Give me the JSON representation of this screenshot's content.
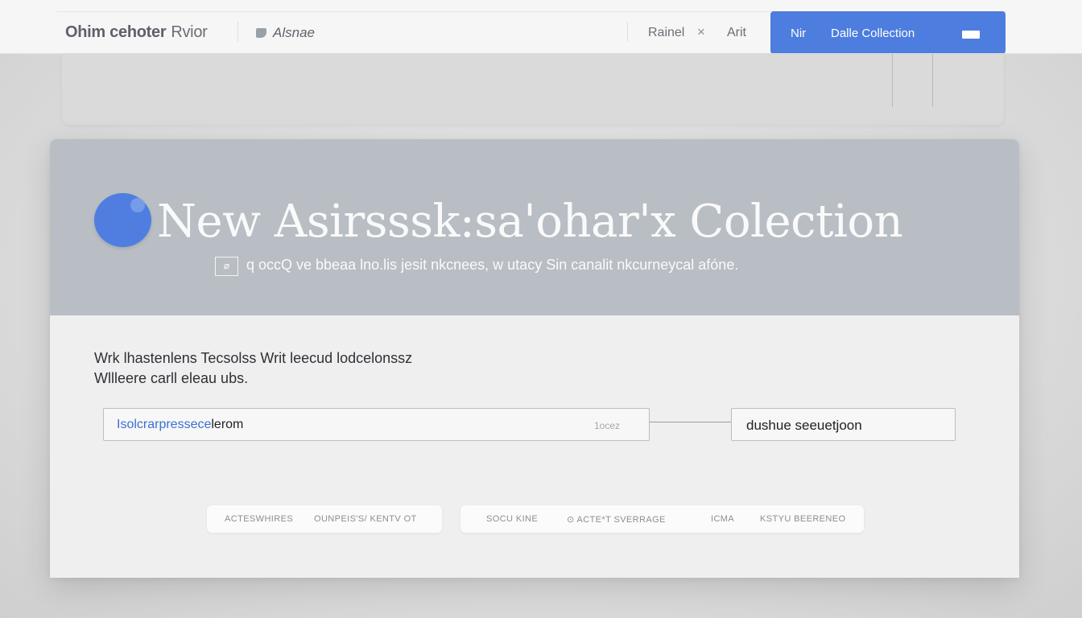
{
  "toolbar": {
    "app_title": "Ohim cehoter",
    "app_subtitle": "Rvior",
    "file_tab_label": "Alsnae",
    "file_icon": "file-icon",
    "item_rainel": "Rainel",
    "close_glyph": "×",
    "item_arit": "Arit",
    "primary_left": "Nir",
    "primary_label": "Dalle  Collection",
    "primary_icon": "bar-icon",
    "accent_color": "#4d7dde"
  },
  "dialog": {
    "title": "New Asirsssk:sa'ohar'x Colection",
    "subtitle_icon_glyph": "⌀",
    "subtitle": "q occQ ve bbeaa lno.lis jesit nkcnees,  w utacy Sin canalit nkcurneycal afóne.",
    "description_line1": "Wrk lhastenlens Tecsolss Writ leecud lodcelonssz",
    "description_line2": "Wllleere carll eleau ubs.",
    "url_field_value_blue": "Isolcrarpressece",
    "url_field_value_dark": "lerom",
    "url_field_hint": "1ocez",
    "select_value": "dushue seeuetjoon",
    "pill_a": [
      "ACTESWHIRES",
      "OUNPEIS'S/   KENTV OT"
    ],
    "pill_b": [
      "SOCU KINE",
      "⊙ ACTE*T   SVERRAGE",
      "ICMA",
      "KSTYU   BEERENEO"
    ]
  }
}
